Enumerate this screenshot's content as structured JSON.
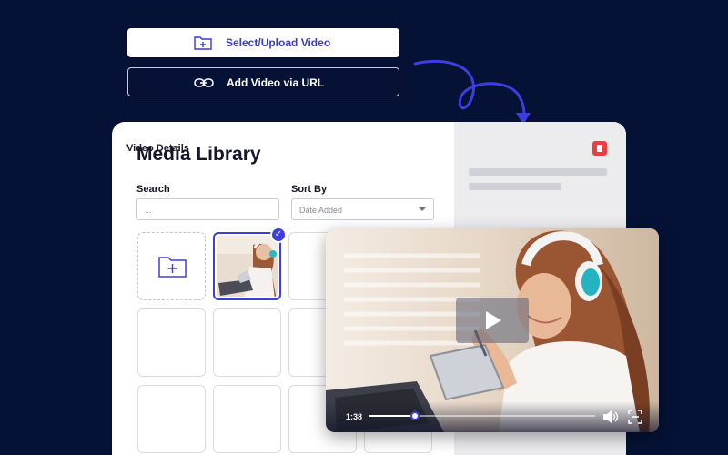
{
  "actions": {
    "upload_label": "Select/Upload Video",
    "url_label": "Add Video via URL",
    "upload_icon": "folder-plus-icon",
    "url_icon": "link-icon"
  },
  "library": {
    "title": "Media Library",
    "search": {
      "label": "Search",
      "value": "..."
    },
    "sort": {
      "label": "Sort By",
      "selected": "Date Added"
    }
  },
  "details": {
    "title": "Video Details",
    "delete_icon": "trash-icon"
  },
  "player": {
    "time": "1:38",
    "progress": 0.2
  },
  "colors": {
    "background": "#061235",
    "accent": "#3c3ee0",
    "delete": "#f03c3c"
  }
}
